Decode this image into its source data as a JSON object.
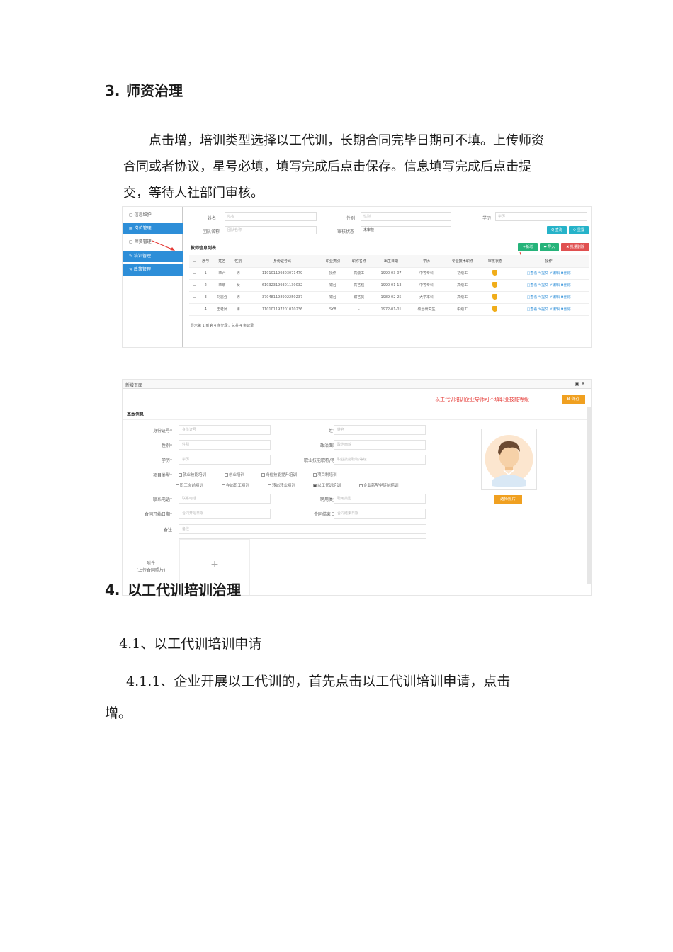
{
  "section3": {
    "number": "3.",
    "title": "师资治理",
    "paragraph_lines": [
      "点击增，培训类型选择以工代训，长期合同完毕日期可不填。上传师资",
      "合同或者协议，星号必填，填写完成后点击保存。信息填写完成后点击提",
      "交，等待人社部门审核。"
    ]
  },
  "screenshot1": {
    "sidebar": [
      "信息维护",
      "岗位管理",
      "师资管理",
      "培训管理",
      "政策管理"
    ],
    "filters": {
      "name_label": "姓名",
      "name_placeholder": "姓名",
      "gender_label": "性别",
      "gender_placeholder": "性别",
      "edu_label": "学历",
      "edu_placeholder": "学历",
      "org_label": "团队名称",
      "org_placeholder": "团队名称",
      "status_label": "审核状态",
      "status_value": "未审核"
    },
    "buttons": {
      "search": "Q 查询",
      "reset": "⟳ 重置",
      "add": "+新增",
      "import": "➦ 导入",
      "batch_delete": "✖ 批量删除"
    },
    "list_title": "教师信息列表",
    "columns": [
      "序号",
      "姓名",
      "性别",
      "身份证号码",
      "职业类别",
      "职称名称",
      "出生日期",
      "学历",
      "专业技术职称",
      "审核状态",
      "操作"
    ],
    "rows": [
      [
        "1",
        "李六",
        "男",
        "110101199303071479",
        "操作",
        "高级工",
        "1990-03-07",
        "中等专科",
        "初级工",
        "",
        "□查看 ✎提交 ✐编辑 ✖删除"
      ],
      [
        "2",
        "李萌",
        "女",
        "610323199301130032",
        "钳台",
        "高艺程",
        "1990-01-13",
        "中等专科",
        "高级工",
        "",
        "□查看 ✎提交 ✐编辑 ✖删除"
      ],
      [
        "3",
        "刘志强",
        "男",
        "370481198902250237",
        "钳台",
        "钳艺员",
        "1989-02-25",
        "大学本科",
        "高级工",
        "",
        "□查看 ✎提交 ✐编辑 ✖删除"
      ],
      [
        "4",
        "王老师",
        "男",
        "110101197201010236",
        "SYB",
        "-",
        "1972-01-01",
        "硕士研究生",
        "中级工",
        "",
        "□查看 ✎提交 ✐编辑 ✖删除"
      ]
    ],
    "footer": "显示第 1 到第 4 条记录，总共 4 条记录"
  },
  "screenshot2": {
    "window_title": "新增页面",
    "window_controls": "▣ ✕",
    "notice": "以工代训培训企业导师可不填职业技能等级",
    "save_button": "B 保存",
    "section_title": "基本信息",
    "fields": {
      "id_label": "身份证号*",
      "id_placeholder": "身份证号",
      "name_label": "姓名*",
      "name_placeholder": "姓名",
      "gender_label": "性别*",
      "gender_placeholder": "性别",
      "politics_label": "政治面貌*",
      "politics_placeholder": "政治面貌",
      "edu_label": "学历*",
      "edu_placeholder": "学历",
      "skill_label": "职业技能职称/等级",
      "skill_placeholder": "职业技能职称/等级",
      "type_label": "项目类型*",
      "phone_label": "联系电话*",
      "phone_placeholder": "联系电话",
      "hire_label": "聘用类型*",
      "hire_placeholder": "聘用类型",
      "start_label": "合同开始日期*",
      "start_placeholder": "合同开始日期",
      "end_label": "合同结束日期",
      "end_placeholder": "合同结束日期",
      "note_label": "备注",
      "note_placeholder": "备注",
      "attach_label": "附件",
      "attach_sub": "(上传合同照片)",
      "attach_plus": "+"
    },
    "types_row1": [
      "就业技能培训",
      "创业培训",
      "岗位技能提升培训",
      "项目制培训"
    ],
    "types_row2": [
      "职工岗前培训",
      "在岗职工培训",
      "转岗转业培训",
      "以工代训培训",
      "企业新型学徒制培训"
    ],
    "photo_button": "选择照片"
  },
  "section4": {
    "number": "4.",
    "title": "以工代训培训治理",
    "sub1": "4.1、以工代训培训申请",
    "sub2_lines": [
      "4.1.1、企业开展以工代训的，首先点击以工代训培训申请，点击",
      "增。"
    ]
  }
}
